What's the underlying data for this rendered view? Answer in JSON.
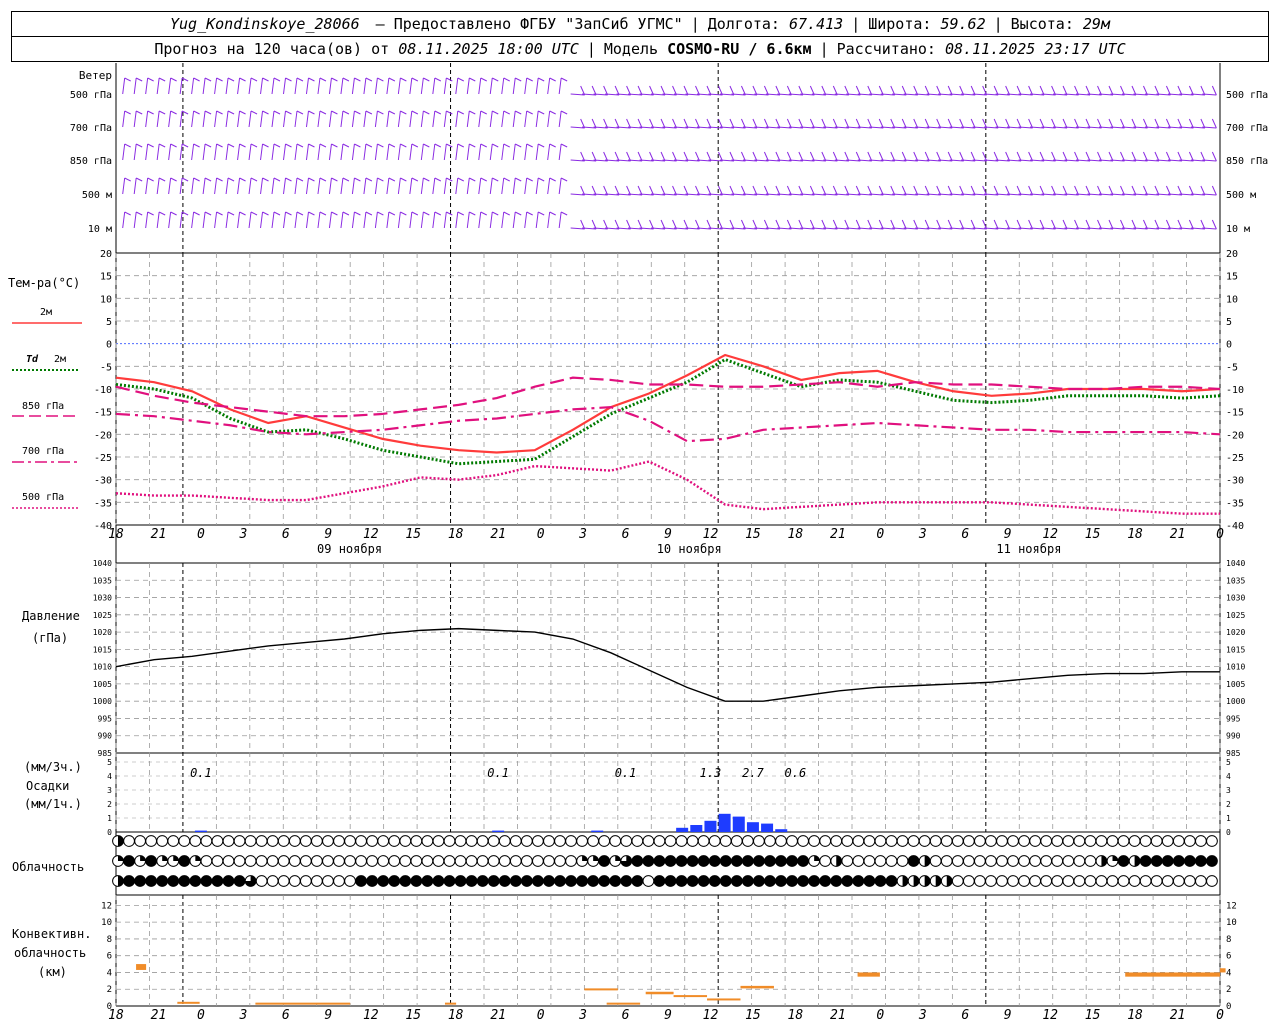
{
  "header": {
    "station": "Yug_Kondinskoye_28066",
    "provider": "– Предоставлено ФГБУ \"ЗапСиб УГМС\"",
    "lon_label": "Долгота:",
    "lon_value": "67.413",
    "lat_label": "Широта:",
    "lat_value": "59.62",
    "alt_label": "Высота:",
    "alt_value": "29м",
    "forecast_label": "Прогноз на 120 часа(ов) от",
    "forecast_time": "08.11.2025 18:00 UTC",
    "model_label": "Модель",
    "model_value": "COSMO-RU / 6.6км",
    "calc_label": "Рассчитано:",
    "calc_time": "08.11.2025 23:17 UTC"
  },
  "colors": {
    "wind": "#8a2be2",
    "t2m": "#ff3b3b",
    "td2m": "#007a00",
    "level": "#e0107e",
    "pressure": "#000000",
    "precip": "#1e3cff",
    "conv": "#f08c28",
    "grid": "#9a9a9a"
  },
  "chart_data": [
    {
      "type": "wind_barbs",
      "title": "Ветер",
      "levels": [
        "500 гПа",
        "700 гПа",
        "850 гПа",
        "500 м",
        "10 м"
      ],
      "barb_style": "feathers point north-west/north in first half, turning west/north-west after second day"
    },
    {
      "type": "line",
      "title": "Тем-ра(°С)",
      "ylim": [
        -40,
        20
      ],
      "yticks": [
        20,
        15,
        10,
        5,
        0,
        -5,
        -10,
        -15,
        -20,
        -25,
        -30,
        -35,
        -40
      ],
      "x_hours_from_start": [
        0,
        3,
        6,
        9,
        12,
        15,
        18,
        21,
        24,
        27,
        30,
        33,
        36,
        39,
        42,
        45,
        48,
        51,
        54,
        57,
        60,
        63,
        66,
        69,
        72,
        75,
        78,
        81,
        84,
        87
      ],
      "series": [
        {
          "name": "2м",
          "style": "solid",
          "values": [
            -7.5,
            -8.5,
            -10.5,
            -14.5,
            -17.5,
            -16,
            -18.5,
            -21,
            -22.5,
            -23.5,
            -24,
            -23.5,
            -19,
            -14,
            -11,
            -7,
            -2.5,
            -5,
            -8,
            -6.5,
            -6,
            -8.5,
            -10.5,
            -11.5,
            -11,
            -10,
            -10,
            -10,
            -10.5,
            -10
          ]
        },
        {
          "name": "Td 2м",
          "style": "dotted",
          "values": [
            -9,
            -10,
            -12,
            -16.5,
            -19.5,
            -19,
            -21,
            -23.5,
            -25,
            -26.5,
            -26,
            -25.5,
            -20.5,
            -15.5,
            -12,
            -8.5,
            -3.5,
            -6.5,
            -9.5,
            -8,
            -8.5,
            -10.5,
            -12.5,
            -13,
            -12.5,
            -11.5,
            -11.5,
            -11.5,
            -12,
            -11.5
          ]
        },
        {
          "name": "850 гПа",
          "style": "dashed",
          "values": [
            -9.5,
            -11.5,
            -13,
            -14,
            -15,
            -16,
            -16,
            -15.5,
            -14.5,
            -13.5,
            -12,
            -9.5,
            -7.5,
            -8,
            -9,
            -9,
            -9.5,
            -9.5,
            -9,
            -8.5,
            -9.5,
            -8.5,
            -9,
            -9,
            -9.5,
            -10,
            -10,
            -9.5,
            -9.5,
            -10
          ]
        },
        {
          "name": "700 гПа",
          "style": "dashdot",
          "values": [
            -15.5,
            -16,
            -17,
            -18,
            -19.5,
            -20,
            -19.5,
            -19,
            -18,
            -17,
            -16.5,
            -15.5,
            -14.5,
            -14,
            -17,
            -21.5,
            -21,
            -19,
            -18.5,
            -18,
            -17.5,
            -18,
            -18.5,
            -19,
            -19,
            -19.5,
            -19.5,
            -19.5,
            -19.5,
            -20
          ]
        },
        {
          "name": "500 гПа",
          "style": "dotted",
          "values": [
            -33,
            -33.5,
            -33.5,
            -34,
            -34.5,
            -34.5,
            -33,
            -31.5,
            -29.5,
            -30,
            -29,
            -27,
            -27.5,
            -28,
            -26,
            -30,
            -35.5,
            -36.5,
            -36,
            -35.5,
            -35,
            -35,
            -35,
            -35,
            -35.5,
            -36,
            -36.5,
            -37,
            -37.5,
            -37.5
          ]
        }
      ]
    },
    {
      "type": "line",
      "title": "Давление",
      "ylabel": "(гПа)",
      "ylim": [
        985,
        1040
      ],
      "yticks": [
        1040,
        1035,
        1030,
        1025,
        1020,
        1015,
        1010,
        1005,
        1000,
        995,
        990,
        985
      ],
      "x_hours_from_start": [
        0,
        3,
        6,
        9,
        12,
        15,
        18,
        21,
        24,
        27,
        30,
        33,
        36,
        39,
        42,
        45,
        48,
        51,
        54,
        57,
        60,
        63,
        66,
        69,
        72,
        75,
        78,
        81,
        84,
        87
      ],
      "values": [
        1010,
        1012,
        1013,
        1014.5,
        1016,
        1017,
        1018,
        1019.5,
        1020.5,
        1021,
        1020.5,
        1020,
        1018,
        1014,
        1009,
        1004,
        1000,
        1000,
        1001.5,
        1003,
        1004,
        1004.5,
        1005,
        1005.5,
        1006.5,
        1007.5,
        1008,
        1008,
        1008.5,
        1008.5
      ]
    },
    {
      "type": "bar",
      "title": "Осадки",
      "ylabel": "(мм/1ч.)",
      "ylabel_top": "(мм/3ч.)",
      "ylim": [
        0,
        5
      ],
      "yticks": [
        5,
        4,
        3,
        2,
        1,
        0
      ],
      "three_hour_totals": [
        {
          "hour": 6,
          "label": "0.1"
        },
        {
          "hour": 27,
          "label": "0.1"
        },
        {
          "hour": 36,
          "label": "0.1"
        },
        {
          "hour": 42,
          "label": "1.3"
        },
        {
          "hour": 45,
          "label": "2.7"
        },
        {
          "hour": 48,
          "label": "0.6"
        }
      ],
      "hourly_bars": [
        {
          "hour": 6,
          "value": 0.1
        },
        {
          "hour": 27,
          "value": 0.1
        },
        {
          "hour": 34,
          "value": 0.1
        },
        {
          "hour": 40,
          "value": 0.3
        },
        {
          "hour": 41,
          "value": 0.5
        },
        {
          "hour": 42,
          "value": 0.8
        },
        {
          "hour": 43,
          "value": 1.3
        },
        {
          "hour": 44,
          "value": 1.1
        },
        {
          "hour": 45,
          "value": 0.7
        },
        {
          "hour": 46,
          "value": 0.6
        },
        {
          "hour": 47,
          "value": 0.2
        }
      ]
    },
    {
      "type": "table",
      "title": "Облачность",
      "rows": [
        "HCLLAAAAAAAAAAAAAAAAAAAAAAAAAAAAAAAAAAAAAAAAAAAAAAAAAAAAAAAAAAAAAAAAAAAAAAAAAAAAAAAAAAAAAAAAAAAAAAAAAAAAA",
        "QFQFQQFQAAAAAAAAAAAAAAAAAAAAAAAAAAAAAAAAAAQQFQTFFFFFFFFFFFFFFFFQAHAAAAAAFHAAAAAAAAAAAAAAAHQFHFFFFFFFFFF",
        "HFFFFFFFFFFFTAAAAAAAAAFFFFFFFFFFFFFFFFFFFFFFFFFFAFFFFFFFFFFFFFFFFFFFFFFHHHHHAAAAAAAAAAAAAAAAAAAAAAAAAAAAAAAA"
      ],
      "legend": {
        "A": "clear",
        "Q": "quarter",
        "H": "half",
        "T": "three-quarter",
        "F": "overcast"
      }
    },
    {
      "type": "bar",
      "title": "Конвективн. облачность",
      "ylabel": "(км)",
      "ylim": [
        0,
        13
      ],
      "yticks": [
        12,
        10,
        8,
        6,
        4,
        2,
        0
      ],
      "segments": [
        {
          "start_hour": 1.8,
          "end_hour": 2.7,
          "bottom_km": 4.3,
          "top_km": 5.0
        },
        {
          "start_hour": 5.5,
          "end_hour": 7.5,
          "bottom_km": 0.3,
          "top_km": 0.5
        },
        {
          "start_hour": 12.5,
          "end_hour": 21,
          "bottom_km": 0.2,
          "top_km": 0.4
        },
        {
          "start_hour": 29.5,
          "end_hour": 30.5,
          "bottom_km": 0.2,
          "top_km": 0.4
        },
        {
          "start_hour": 42,
          "end_hour": 45,
          "bottom_km": 1.9,
          "top_km": 2.1
        },
        {
          "start_hour": 44,
          "end_hour": 47,
          "bottom_km": 0.2,
          "top_km": 0.4
        },
        {
          "start_hour": 47.5,
          "end_hour": 50,
          "bottom_km": 1.4,
          "top_km": 1.7
        },
        {
          "start_hour": 50,
          "end_hour": 53,
          "bottom_km": 1.1,
          "top_km": 1.3
        },
        {
          "start_hour": 53,
          "end_hour": 56,
          "bottom_km": 0.7,
          "top_km": 0.9
        },
        {
          "start_hour": 56,
          "end_hour": 59,
          "bottom_km": 2.1,
          "top_km": 2.4
        },
        {
          "start_hour": 66.5,
          "end_hour": 68.5,
          "bottom_km": 3.5,
          "top_km": 4.0
        },
        {
          "start_hour": 90.5,
          "end_hour": 99,
          "bottom_km": 3.5,
          "top_km": 4.0
        },
        {
          "start_hour": 99,
          "end_hour": 99.5,
          "bottom_km": 4.0,
          "top_km": 4.5
        }
      ]
    }
  ],
  "time_axis": {
    "top_ticks": [
      "18",
      "21",
      "0",
      "3",
      "6",
      "9",
      "12",
      "15",
      "18",
      "21",
      "0",
      "3",
      "6",
      "9",
      "12",
      "15",
      "18",
      "21",
      "0",
      "3",
      "6",
      "9",
      "12",
      "15",
      "18",
      "21",
      "0"
    ],
    "bottom_ticks": [
      "18",
      "21",
      "0",
      "3",
      "6",
      "9",
      "12",
      "15",
      "18",
      "21",
      "0",
      "3",
      "6",
      "9",
      "12",
      "15",
      "18",
      "21",
      "0",
      "3",
      "6",
      "9",
      "12",
      "15",
      "18",
      "21",
      "0"
    ],
    "dates": [
      {
        "label": "09 ноября",
        "center_hour": 16.5
      },
      {
        "label": "10 ноября",
        "center_hour": 40.5
      },
      {
        "label": "11 ноября",
        "center_hour": 64.5
      }
    ]
  },
  "legend": {
    "t2m": "2м",
    "td_italic": "Td",
    "td2m": "2м",
    "l850": "850 гПа",
    "l700": "700 гПа",
    "l500": "500 гПа"
  }
}
